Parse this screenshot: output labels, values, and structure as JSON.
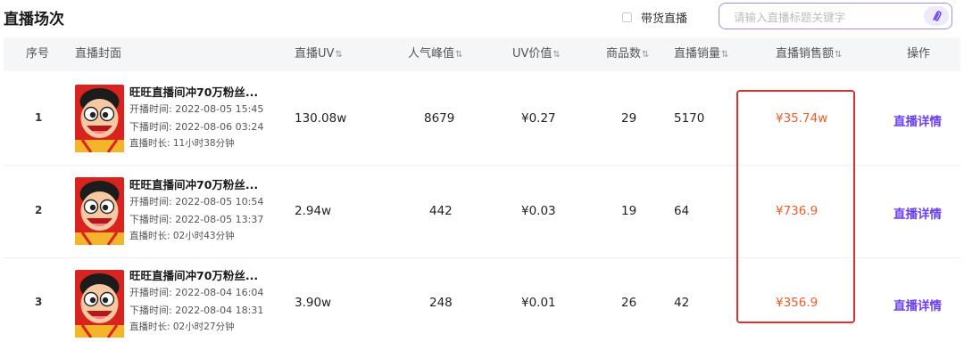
{
  "page": {
    "title": "直播场次"
  },
  "filter": {
    "label": "带货直播",
    "checked": false
  },
  "search": {
    "placeholder": "请输入直播标题关键字"
  },
  "table": {
    "columns": {
      "index": "序号",
      "cover": "直播封面",
      "uv": "直播UV",
      "peak": "人气峰值",
      "uv_value": "UV价值",
      "goods": "商品数",
      "sales": "直播销量",
      "revenue": "直播销售额",
      "action": "操作"
    },
    "rows": [
      {
        "index": "1",
        "title": "旺旺直播间冲70万粉丝...",
        "start": "开播时间: 2022-08-05 15:45",
        "end": "下播时间: 2022-08-06 03:24",
        "duration": "直播时长: 11小时38分钟",
        "uv": "130.08w",
        "peak": "8679",
        "uv_value": "¥0.27",
        "goods": "29",
        "sales": "5170",
        "revenue": "¥35.74w",
        "action": "直播详情"
      },
      {
        "index": "2",
        "title": "旺旺直播间冲70万粉丝...",
        "start": "开播时间: 2022-08-05 10:54",
        "end": "下播时间: 2022-08-05 13:37",
        "duration": "直播时长: 02小时43分钟",
        "uv": "2.94w",
        "peak": "442",
        "uv_value": "¥0.03",
        "goods": "19",
        "sales": "64",
        "revenue": "¥736.9",
        "action": "直播详情"
      },
      {
        "index": "3",
        "title": "旺旺直播间冲70万粉丝...",
        "start": "开播时间: 2022-08-04 16:04",
        "end": "下播时间: 2022-08-04 18:31",
        "duration": "直播时长: 02小时27分钟",
        "uv": "3.90w",
        "peak": "248",
        "uv_value": "¥0.01",
        "goods": "26",
        "sales": "42",
        "revenue": "¥356.9",
        "action": "直播详情"
      }
    ]
  },
  "colors": {
    "accent": "#6a40f0",
    "revenue": "#f05a24",
    "highlight_border": "#e0302c",
    "header_bg": "#f5f6f8"
  },
  "icons": {
    "search_button": "link-search-icon",
    "sort": "sort-arrows-icon",
    "cover": "wangzai-mascot-thumbnail"
  }
}
